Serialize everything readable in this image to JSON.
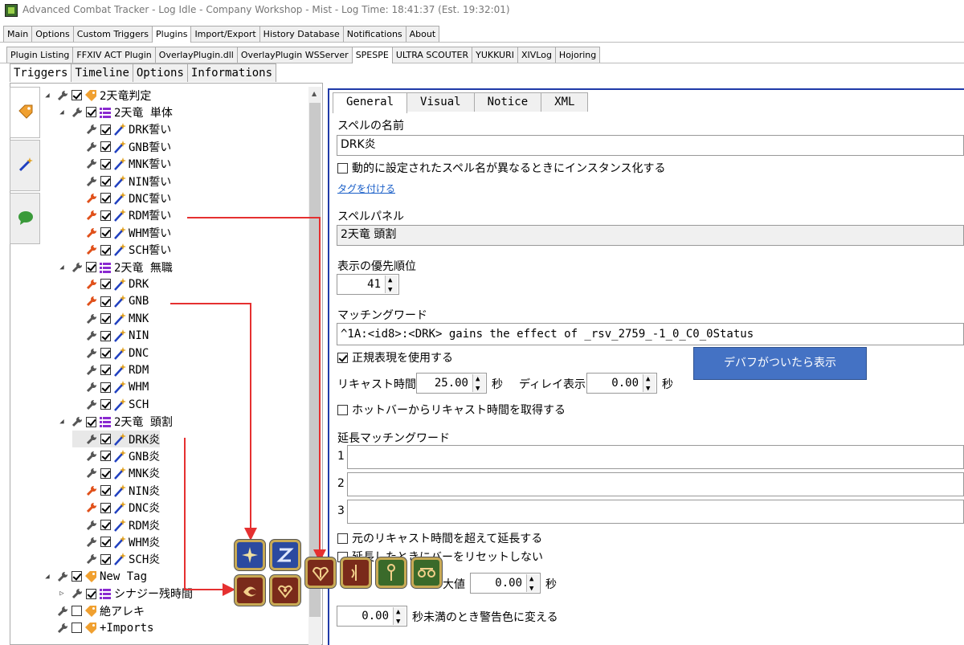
{
  "window": {
    "title": "Advanced Combat Tracker - Log Idle - Company Workshop - Mist - Log Time: 18:41:37 (Est. 19:32:01)"
  },
  "main_tabs": [
    "Main",
    "Options",
    "Custom Triggers",
    "Plugins",
    "Import/Export",
    "History Database",
    "Notifications",
    "About"
  ],
  "plugin_tabs": [
    "Plugin Listing",
    "FFXIV ACT Plugin",
    "OverlayPlugin.dll",
    "OverlayPlugin WSServer",
    "SPESPE",
    "ULTRA SCOUTER",
    "YUKKURI",
    "XIVLog",
    "Hojoring"
  ],
  "spespe_tabs": [
    "Triggers",
    "Timeline",
    "Options",
    "Informations"
  ],
  "tree": [
    {
      "depth": 0,
      "exp": "open",
      "checked": true,
      "icon": "tag-icon",
      "label": "2天竜判定",
      "wrench": "gray"
    },
    {
      "depth": 1,
      "exp": "open",
      "checked": true,
      "icon": "list-icon",
      "label": "2天竜 単体",
      "wrench": "gray"
    },
    {
      "depth": 2,
      "exp": "",
      "checked": true,
      "icon": "wand-icon",
      "label": "DRK誓い",
      "wrench": "gray"
    },
    {
      "depth": 2,
      "exp": "",
      "checked": true,
      "icon": "wand-icon",
      "label": "GNB誓い",
      "wrench": "gray"
    },
    {
      "depth": 2,
      "exp": "",
      "checked": true,
      "icon": "wand-icon",
      "label": "MNK誓い",
      "wrench": "gray"
    },
    {
      "depth": 2,
      "exp": "",
      "checked": true,
      "icon": "wand-icon",
      "label": "NIN誓い",
      "wrench": "gray"
    },
    {
      "depth": 2,
      "exp": "",
      "checked": true,
      "icon": "wand-icon",
      "label": "DNC誓い",
      "wrench": "red"
    },
    {
      "depth": 2,
      "exp": "",
      "checked": true,
      "icon": "wand-icon",
      "label": "RDM誓い",
      "wrench": "red"
    },
    {
      "depth": 2,
      "exp": "",
      "checked": true,
      "icon": "wand-icon",
      "label": "WHM誓い",
      "wrench": "red"
    },
    {
      "depth": 2,
      "exp": "",
      "checked": true,
      "icon": "wand-icon",
      "label": "SCH誓い",
      "wrench": "red"
    },
    {
      "depth": 1,
      "exp": "open",
      "checked": true,
      "icon": "list-icon",
      "label": "2天竜 無職",
      "wrench": "gray"
    },
    {
      "depth": 2,
      "exp": "",
      "checked": true,
      "icon": "wand-icon",
      "label": "DRK",
      "wrench": "red"
    },
    {
      "depth": 2,
      "exp": "",
      "checked": true,
      "icon": "wand-icon",
      "label": "GNB",
      "wrench": "red"
    },
    {
      "depth": 2,
      "exp": "",
      "checked": true,
      "icon": "wand-icon",
      "label": "MNK",
      "wrench": "gray"
    },
    {
      "depth": 2,
      "exp": "",
      "checked": true,
      "icon": "wand-icon",
      "label": "NIN",
      "wrench": "gray"
    },
    {
      "depth": 2,
      "exp": "",
      "checked": true,
      "icon": "wand-icon",
      "label": "DNC",
      "wrench": "gray"
    },
    {
      "depth": 2,
      "exp": "",
      "checked": true,
      "icon": "wand-icon",
      "label": "RDM",
      "wrench": "gray"
    },
    {
      "depth": 2,
      "exp": "",
      "checked": true,
      "icon": "wand-icon",
      "label": "WHM",
      "wrench": "gray"
    },
    {
      "depth": 2,
      "exp": "",
      "checked": true,
      "icon": "wand-icon",
      "label": "SCH",
      "wrench": "gray"
    },
    {
      "depth": 1,
      "exp": "open",
      "checked": true,
      "icon": "list-icon",
      "label": "2天竜 頭割",
      "wrench": "gray"
    },
    {
      "depth": 2,
      "exp": "",
      "checked": true,
      "icon": "wand-icon",
      "label": "DRK炎",
      "wrench": "gray",
      "selected": true
    },
    {
      "depth": 2,
      "exp": "",
      "checked": true,
      "icon": "wand-icon",
      "label": "GNB炎",
      "wrench": "gray"
    },
    {
      "depth": 2,
      "exp": "",
      "checked": true,
      "icon": "wand-icon",
      "label": "MNK炎",
      "wrench": "gray"
    },
    {
      "depth": 2,
      "exp": "",
      "checked": true,
      "icon": "wand-icon",
      "label": "NIN炎",
      "wrench": "red"
    },
    {
      "depth": 2,
      "exp": "",
      "checked": true,
      "icon": "wand-icon",
      "label": "DNC炎",
      "wrench": "red"
    },
    {
      "depth": 2,
      "exp": "",
      "checked": true,
      "icon": "wand-icon",
      "label": "RDM炎",
      "wrench": "gray"
    },
    {
      "depth": 2,
      "exp": "",
      "checked": true,
      "icon": "wand-icon",
      "label": "WHM炎",
      "wrench": "gray"
    },
    {
      "depth": 2,
      "exp": "",
      "checked": true,
      "icon": "wand-icon",
      "label": "SCH炎",
      "wrench": "gray"
    },
    {
      "depth": 0,
      "exp": "open",
      "checked": true,
      "icon": "tag-icon",
      "label": "New Tag",
      "wrench": "gray"
    },
    {
      "depth": 1,
      "exp": "closed",
      "checked": true,
      "icon": "list-icon",
      "label": "シナジー残時間",
      "wrench": "gray"
    },
    {
      "depth": 0,
      "exp": "",
      "checked": false,
      "icon": "tag-icon",
      "label": "絶アレキ",
      "wrench": "gray"
    },
    {
      "depth": 0,
      "exp": "",
      "checked": false,
      "icon": "tag-icon",
      "label": "+Imports",
      "wrench": "gray"
    }
  ],
  "detail": {
    "tabs": [
      "General",
      "Visual",
      "Notice",
      "XML"
    ],
    "spell_name_label": "スペルの名前",
    "spell_name_value": "DRK炎",
    "instance_check_label": "動的に設定されたスペル名が異なるときにインスタンス化する",
    "tag_link": "タグを付ける",
    "panel_label": "スペルパネル",
    "panel_value": "2天竜 頭割",
    "priority_label": "表示の優先順位",
    "priority_value": "41",
    "match_label": "マッチングワード",
    "match_value": "^1A:<id8>:<DRK> gains the effect of _rsv_2759_-1_0_C0_0Status",
    "regex_label": "正規表現を使用する",
    "recast_label": "リキャスト時間",
    "recast_value": "25.00",
    "sec1": "秒",
    "delay_label": "ディレイ表示",
    "delay_value": "0.00",
    "sec2": "秒",
    "hotbar_label": "ホットバーからリキャスト時間を取得する",
    "ext_match_label": "延長マッチングワード",
    "ext_rows": [
      "1",
      "2",
      "3"
    ],
    "extend_over_label": "元のリキャスト時間を超えて延長する",
    "no_reset_label": "延長したときにバーをリセットしない",
    "max_label": "大値",
    "max_value": "0.00",
    "sec3": "秒",
    "warn_value": "0.00",
    "warn_label": "秒未満のとき警告色に変える"
  },
  "callout_text": "デバフがついたら表示",
  "colors": {
    "accent": "#1f3aa8",
    "callout": "#4472c4",
    "arrow": "#e53030",
    "job_gold": "#c8aa55"
  }
}
